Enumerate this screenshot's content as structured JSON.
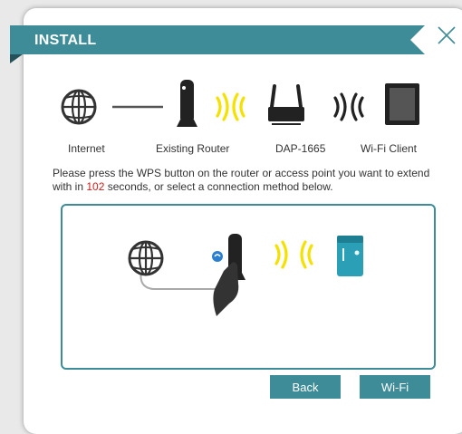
{
  "dialog": {
    "title": "INSTALL",
    "close_icon": "close-x-icon"
  },
  "topology": {
    "labels": [
      "Internet",
      "Existing Router",
      "DAP-1665",
      "Wi-Fi Client"
    ],
    "icons": [
      "globe-icon",
      "router-icon",
      "wifi-signal-icon",
      "extender-icon",
      "wifi-signal-icon",
      "tablet-icon"
    ]
  },
  "instruction": {
    "text_before": "Please press the WPS button on the router or access point you want to extend with in ",
    "countdown": "102",
    "text_after": " seconds, or select a connection method below."
  },
  "animation": {
    "icons": [
      "globe-icon",
      "wps-badge-icon",
      "router-icon",
      "hand-pressing-icon",
      "wifi-signal-icon",
      "extender-device-icon"
    ]
  },
  "buttons": {
    "back": "Back",
    "wifi": "Wi-Fi"
  },
  "colors": {
    "accent": "#3e8c98",
    "signal": "#f5e100",
    "countdown": "#d02020",
    "wps_badge": "#2a7fd0",
    "device": "#2a9fb5"
  }
}
